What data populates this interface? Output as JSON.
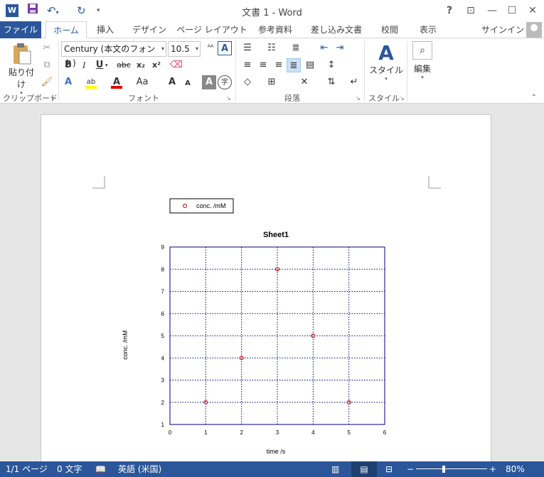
{
  "titlebar": {
    "app_icon": "W",
    "save_icon": "save-icon",
    "undo_icon": "undo-icon",
    "redo_icon": "redo-icon",
    "title": "文書 1 - Word",
    "help": "?",
    "ribbon_display": "⊡",
    "minimize": "—",
    "maximize": "☐",
    "close": "✕"
  },
  "tabs": {
    "file": "ファイル",
    "home": "ホーム",
    "insert": "挿入",
    "design": "デザイン",
    "layout": "ページ レイアウト",
    "references": "参考資料",
    "mailings": "差し込み文書",
    "review": "校閲",
    "view": "表示",
    "signin": "サインイン"
  },
  "ribbon": {
    "paste": "貼り付け",
    "font_name": "Century (本文のフォント)",
    "font_size": "10.5",
    "clipboard_label": "クリップボード",
    "font_label": "フォント",
    "paragraph_label": "段落",
    "style_label": "スタイル",
    "styles_button": "スタイル",
    "editing_button": "編集",
    "bold": "B",
    "italic": "I",
    "underline": "U",
    "strike": "abc",
    "subscript": "x₂",
    "superscript": "x²",
    "case": "Aa",
    "font_color": "A",
    "grow": "A",
    "shrink": "A"
  },
  "status": {
    "page": "1/1 ページ",
    "words": "0 文字",
    "language": "英語 (米国)",
    "zoom": "80%",
    "zoom_minus": "−",
    "zoom_plus": "+"
  },
  "colors": {
    "accent": "#2b579a",
    "axis": "#000080",
    "marker": "#c00000"
  },
  "chart_data": {
    "type": "scatter",
    "title": "Sheet1",
    "xlabel": "time /s",
    "ylabel": "conc. /mM",
    "xlim": [
      0,
      6
    ],
    "ylim": [
      1,
      9
    ],
    "xticks": [
      0,
      1,
      2,
      3,
      4,
      5,
      6
    ],
    "yticks": [
      1,
      2,
      3,
      4,
      5,
      6,
      7,
      8,
      9
    ],
    "grid": true,
    "legend_position": "top-left, outside plot",
    "series": [
      {
        "name": "conc. /mM",
        "x": [
          1,
          2,
          3,
          4,
          5
        ],
        "y": [
          2,
          4,
          8,
          5,
          2
        ]
      }
    ]
  }
}
